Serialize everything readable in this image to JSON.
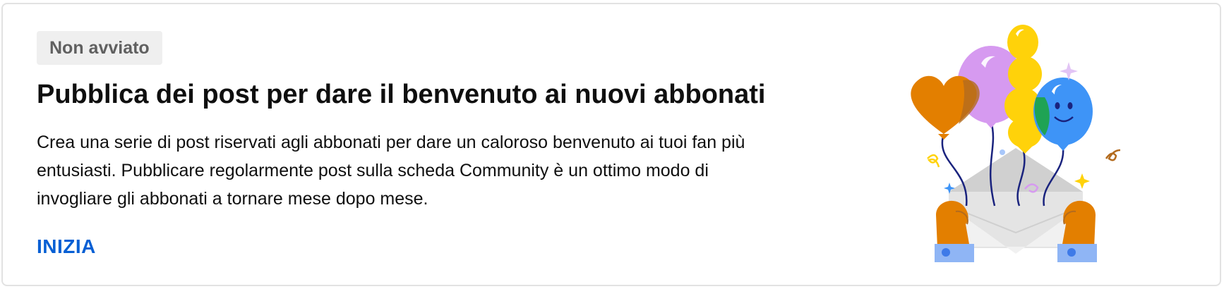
{
  "card": {
    "status_badge": "Non avviato",
    "title": "Pubblica dei post per dare il benvenuto ai nuovi abbonati",
    "description": "Crea una serie di post riservati agli abbonati per dare un caloroso benvenuto ai tuoi fan più entusiasti. Pubblicare regolarmente post sulla scheda Community è un ottimo modo di invogliare gli abbonati a tornare mese dopo mese.",
    "cta_label": "INIZIA",
    "illustration": "balloons-envelope-illustration"
  },
  "colors": {
    "accent_link": "#065fd4",
    "badge_bg": "#efefef",
    "badge_text": "#606060",
    "title_text": "#0f0f0f",
    "card_border": "#e2e2e2",
    "balloon_orange": "#e37f00",
    "balloon_purple": "#d69af0",
    "balloon_yellow": "#ffd20a",
    "balloon_blue": "#3e94f7",
    "balloon_green": "#1fa354"
  }
}
